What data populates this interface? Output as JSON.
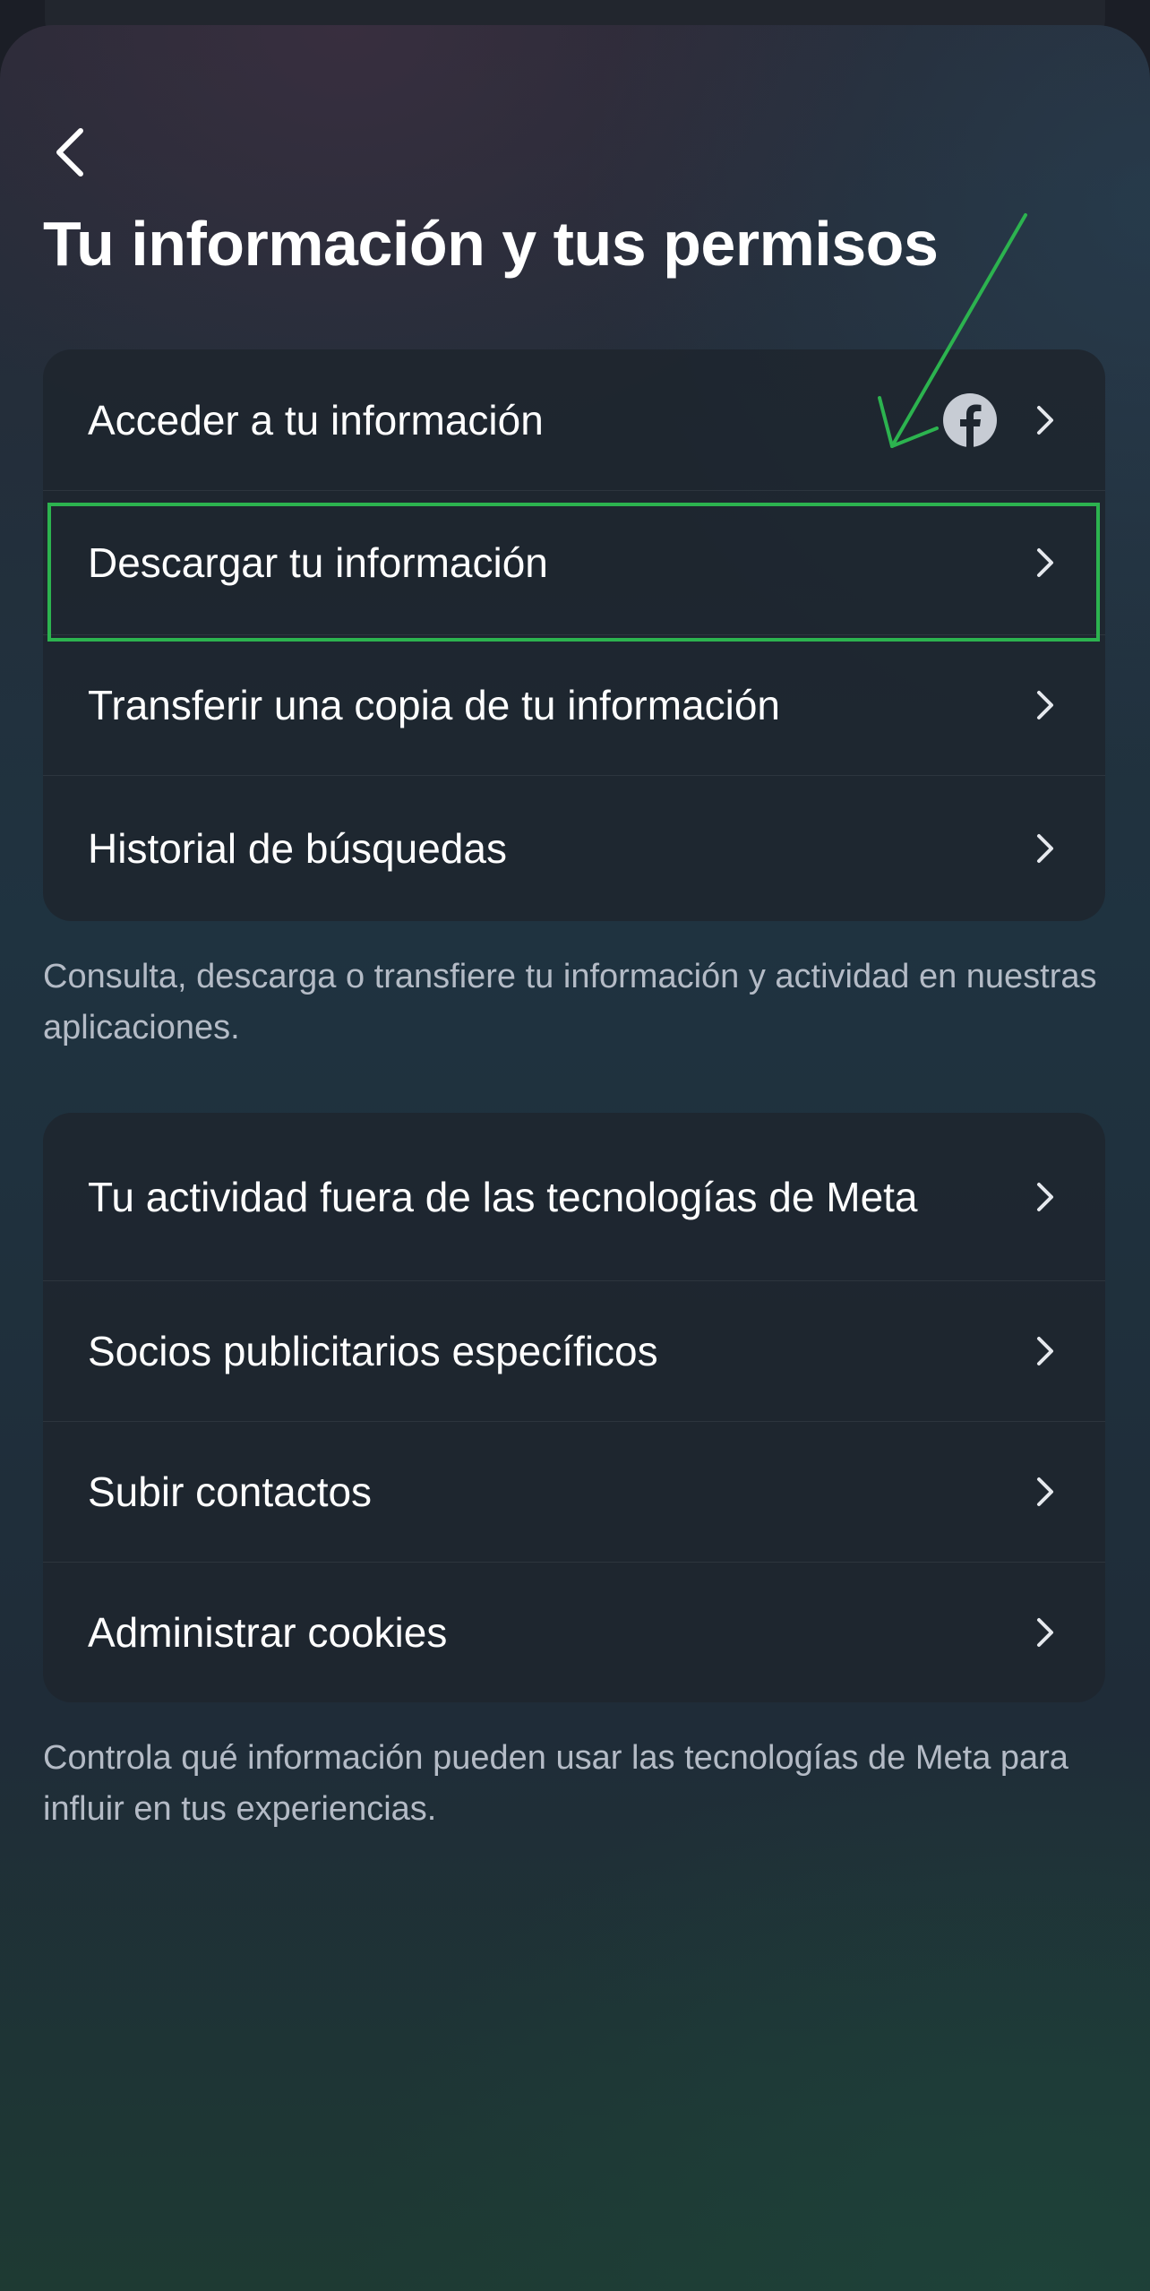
{
  "header": {
    "title": "Tu información y tus permisos"
  },
  "section_info": {
    "items": [
      {
        "label": "Acceder a tu información",
        "icon": "facebook-icon"
      },
      {
        "label": "Descargar tu información",
        "highlighted": true
      },
      {
        "label": "Transferir una copia de tu información"
      },
      {
        "label": "Historial de búsquedas"
      }
    ],
    "description": "Consulta, descarga o transfiere tu información y actividad en nuestras aplicaciones."
  },
  "section_activity": {
    "items": [
      {
        "label": "Tu actividad fuera de las tecnologías de Meta"
      },
      {
        "label": "Socios publicitarios específicos"
      },
      {
        "label": "Subir contactos"
      },
      {
        "label": "Administrar cookies"
      }
    ],
    "description": "Controla qué información pueden usar las tecnologías de Meta para influir en tus experiencias."
  },
  "colors": {
    "annotation": "#2cb34f",
    "text_primary": "#ffffff",
    "text_secondary": "#b4bbc6",
    "card_bg": "#1e262f"
  }
}
